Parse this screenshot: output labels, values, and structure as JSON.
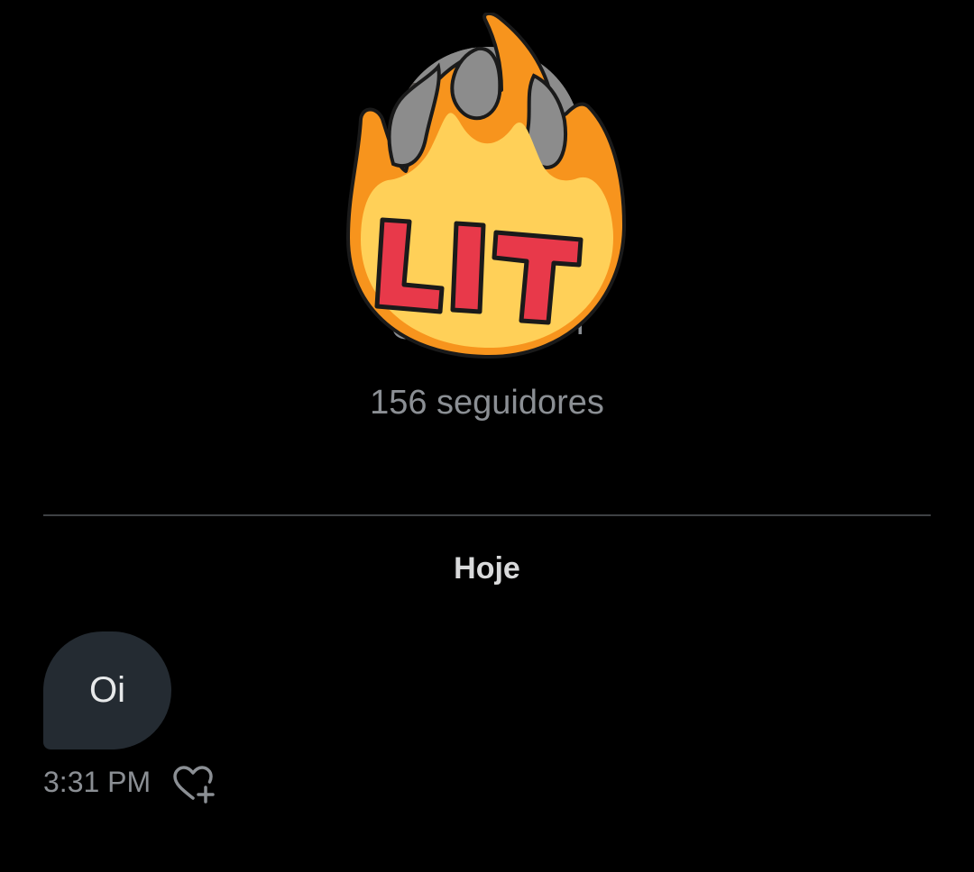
{
  "profile": {
    "handle": "@lucasmnn",
    "followers_text": "156 seguidores"
  },
  "sticker": {
    "text": "LIT",
    "colors": {
      "flame_outer": "#f7941d",
      "flame_inner": "#ffd058",
      "text": "#e8394a",
      "outline": "#1a1a1a"
    }
  },
  "conversation": {
    "day_label": "Hoje",
    "messages": [
      {
        "text": "Oi",
        "time": "3:31 PM",
        "reaction_icon": "heart-plus-icon"
      }
    ]
  },
  "colors": {
    "background": "#000000",
    "bubble": "#242b32",
    "muted_text": "#8b8f94",
    "divider": "#3e4144"
  }
}
